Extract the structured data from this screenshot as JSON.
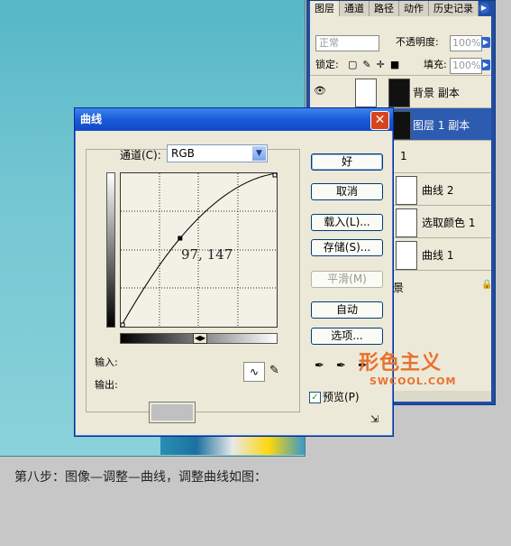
{
  "canvas": {
    "bg_color": "#6cc3d0"
  },
  "layers_panel": {
    "tabs": [
      "图层",
      "通道",
      "路径",
      "动作",
      "历史记录"
    ],
    "blend_mode": "正常",
    "opacity_label": "不透明度:",
    "opacity_value": "100%",
    "lock_label": "锁定:",
    "fill_label": "填充:",
    "fill_value": "100%",
    "layers": [
      {
        "name": "背景 副本",
        "selected": false
      },
      {
        "name": "图层 1 副本",
        "selected": true
      },
      {
        "name": "1",
        "selected": false
      },
      {
        "name": "曲线 2",
        "selected": false
      },
      {
        "name": "选取颜色 1",
        "selected": false
      },
      {
        "name": "曲线 1",
        "selected": false
      },
      {
        "name": "景",
        "selected": false
      }
    ]
  },
  "dialog": {
    "title": "曲线",
    "channel_label": "通道(C):",
    "channel_value": "RGB",
    "point_readout": "97, 147",
    "input_label": "输入:",
    "output_label": "输出:",
    "buttons": {
      "ok": "好",
      "cancel": "取消",
      "load": "载入(L)...",
      "save": "存储(S)...",
      "smooth": "平滑(M)",
      "auto": "自动",
      "options": "选项..."
    },
    "preview_label": "预览(P)",
    "curve_point": {
      "input": 97,
      "output": 147
    }
  },
  "watermark": {
    "text": "形色主义",
    "sub": "SWCOOL.COM"
  },
  "caption": "第八步：图像—调整—曲线，调整曲线如图："
}
